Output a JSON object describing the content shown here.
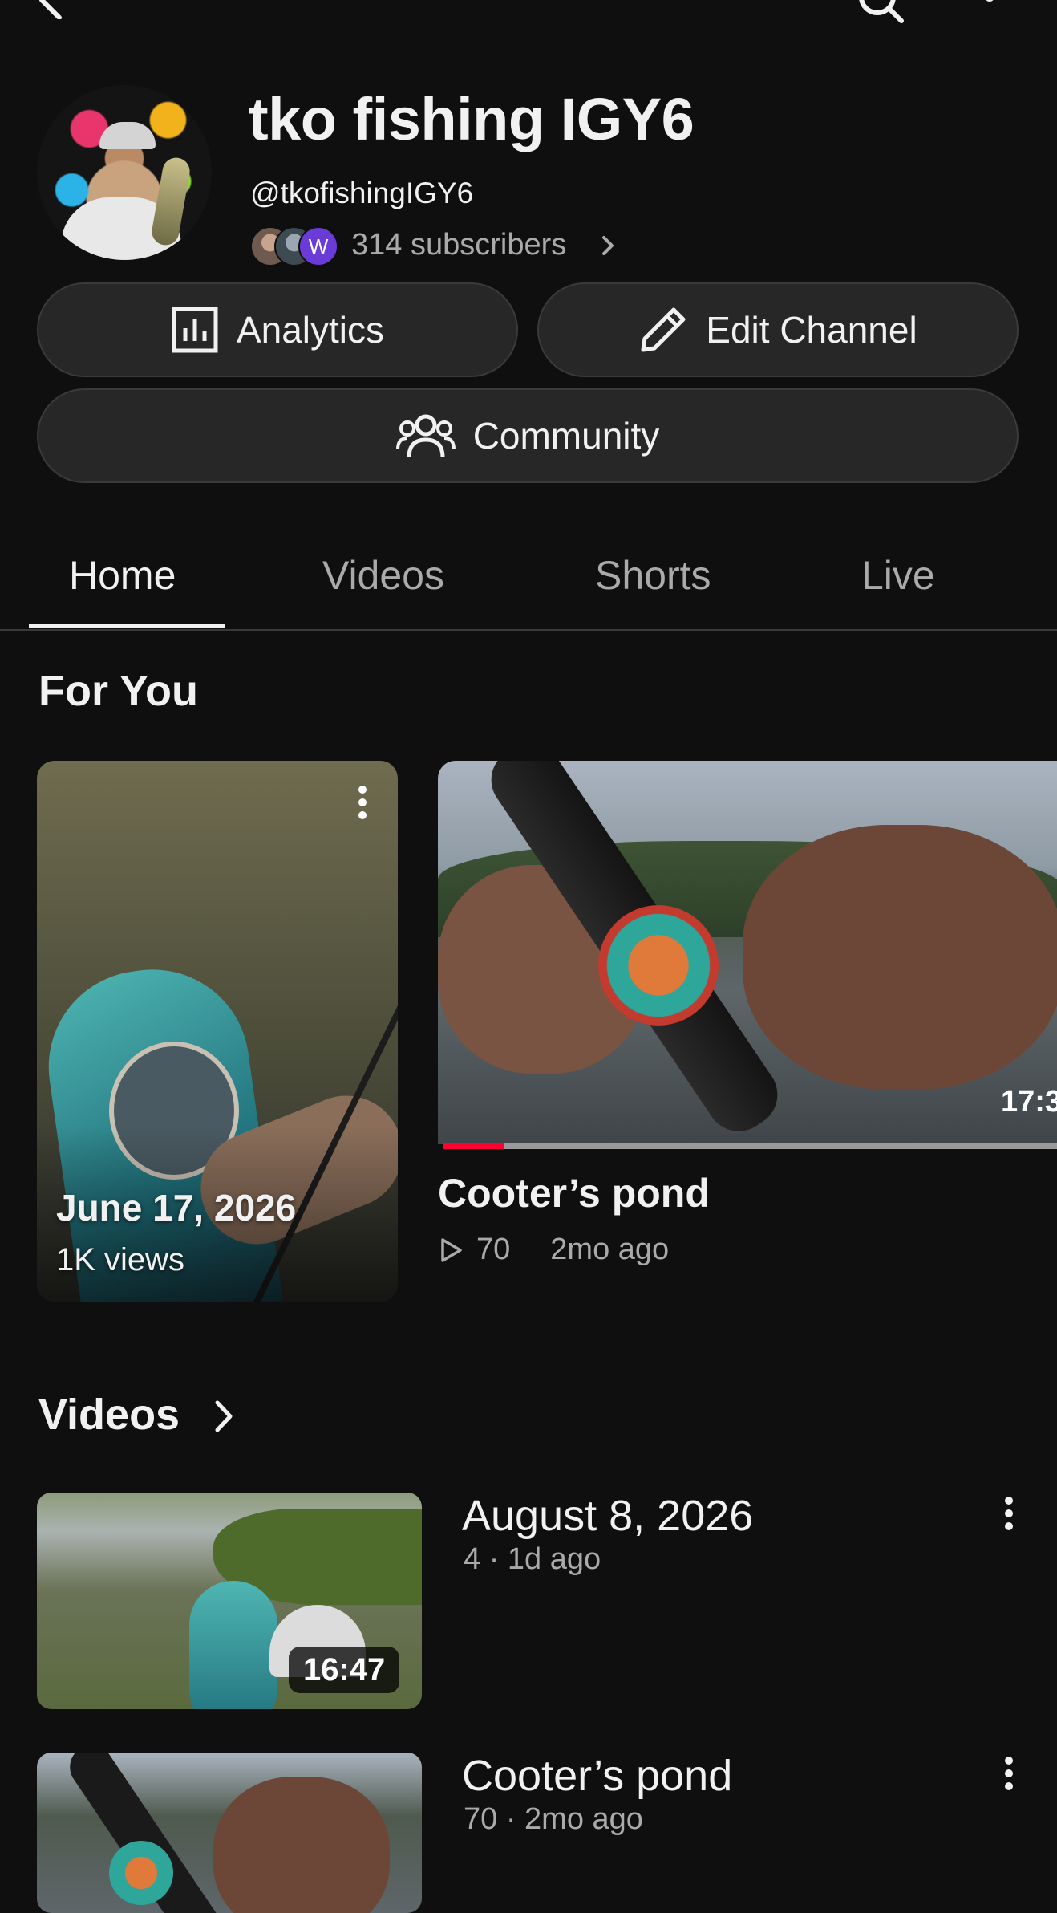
{
  "header": {
    "back_icon": "back-arrow-icon",
    "search_icon": "search-icon",
    "more_icon": "more-vertical-icon"
  },
  "channel": {
    "name": "tko fishing IGY6",
    "handle": "@tkofishingIGY6",
    "subscribers": "314 subscribers",
    "subscriber_avatar_initial": "W"
  },
  "actions": {
    "analytics": "Analytics",
    "edit_channel": "Edit Channel",
    "community": "Community"
  },
  "tabs": [
    {
      "label": "Home",
      "active": true
    },
    {
      "label": "Videos",
      "active": false
    },
    {
      "label": "Shorts",
      "active": false
    },
    {
      "label": "Live",
      "active": false
    }
  ],
  "for_you": {
    "title": "For You",
    "short": {
      "date": "June 17, 2026",
      "views": "1K views"
    },
    "featured": {
      "title": "Cooter’s pond",
      "duration": "17:3",
      "views": "70",
      "age": "2mo ago",
      "watch_progress": 0.1
    }
  },
  "videos_section": {
    "title": "Videos",
    "items": [
      {
        "title": "August 8, 2026",
        "meta": "4 · 1d ago",
        "duration": "16:47"
      },
      {
        "title": "Cooter’s pond",
        "meta": "70 · 2mo ago",
        "duration": ""
      }
    ]
  },
  "colors": {
    "background": "#0f0f0f",
    "button_bg": "#272727",
    "secondary_text": "#aaaaaa",
    "progress_red": "#ff0033"
  }
}
